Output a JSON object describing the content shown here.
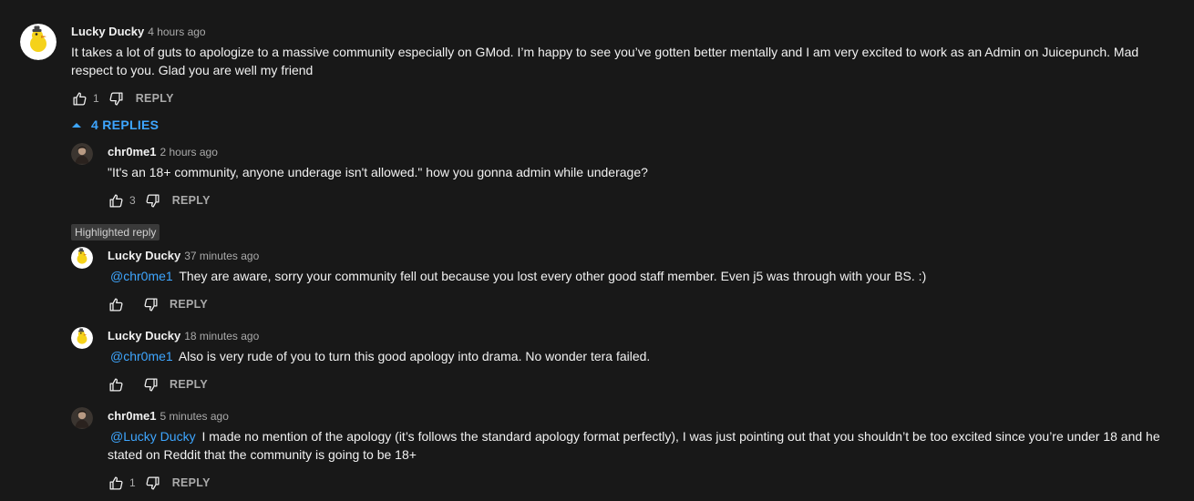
{
  "comment": {
    "author": "Lucky Ducky",
    "time": "4 hours ago",
    "text": "It takes a lot of guts to apologize to a massive community especially on GMod. I’m happy to see you’ve gotten better mentally and I am very excited to work as an Admin on Juicepunch. Mad respect to you. Glad you are well my friend",
    "likes": "1",
    "reply_label": "REPLY",
    "replies_toggle": "4 REPLIES"
  },
  "replies": [
    {
      "author": "chr0me1",
      "time": "2 hours ago",
      "text": "\"It's an 18+ community, anyone underage isn't allowed.\" how you gonna admin while underage?",
      "likes": "3",
      "reply_label": "REPLY"
    },
    {
      "badge": "Highlighted reply",
      "author": "Lucky Ducky",
      "time": "37 minutes ago",
      "mention": "@chr0me1",
      "text": "They are aware, sorry your community fell out because you lost every other good staff member. Even j5 was through with your BS. :)",
      "likes": "",
      "reply_label": "REPLY"
    },
    {
      "author": "Lucky Ducky",
      "time": "18 minutes ago",
      "mention": "@chr0me1",
      "text": "Also is very rude of you to turn this good apology into drama. No wonder tera failed.",
      "likes": "",
      "reply_label": "REPLY"
    },
    {
      "author": "chr0me1",
      "time": "5 minutes ago",
      "mention": "@Lucky Ducky",
      "text": "I made no mention of the apology (it’s follows the standard apology format perfectly), I was just pointing out that you shouldn’t be too excited since you’re under 18 and he stated on Reddit that the community is going to be 18+",
      "likes": "1",
      "reply_label": "REPLY"
    }
  ],
  "colors": {
    "background": "#181818",
    "text": "#f1f1f1",
    "secondary": "#aaaaaa",
    "link": "#3ea6ff"
  },
  "icons": [
    "like-icon",
    "dislike-icon",
    "chevron-up-icon",
    "duck-avatar",
    "user-avatar"
  ]
}
